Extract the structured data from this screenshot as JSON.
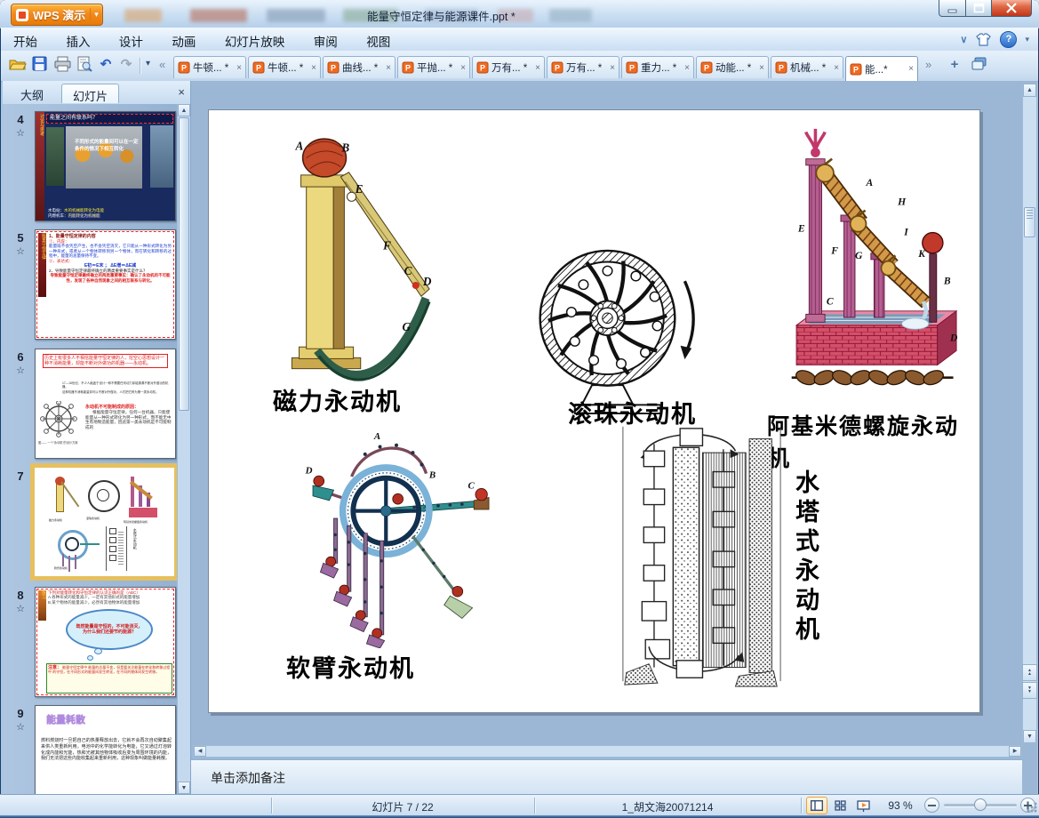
{
  "window": {
    "app_button": "WPS 演示",
    "title": "能量守恒定律与能源课件.ppt *"
  },
  "icons": {
    "ppt": "P",
    "close": "×",
    "star": "☆",
    "chev_left": "«",
    "chev_right": "»",
    "more": "▾",
    "undo": "↶",
    "redo": "↷",
    "plus": "+",
    "arrow_left": "◀",
    "arrow_right": "▶",
    "arrow_up": "▲",
    "arrow_down": "▼",
    "dropdown": "▾",
    "help": "?",
    "collapse": "∨"
  },
  "menu": {
    "items": [
      "开始",
      "插入",
      "设计",
      "动画",
      "幻灯片放映",
      "审阅",
      "视图"
    ]
  },
  "doc_tabs": [
    {
      "label": "牛顿... *"
    },
    {
      "label": "牛顿... *"
    },
    {
      "label": "曲线... *"
    },
    {
      "label": "平抛... *"
    },
    {
      "label": "万有... *"
    },
    {
      "label": "万有... *"
    },
    {
      "label": "重力... *"
    },
    {
      "label": "动能... *"
    },
    {
      "label": "机械... *"
    },
    {
      "label": "能...*"
    }
  ],
  "sidebar": {
    "outline_tab": "大纲",
    "slides_tab": "幻灯片",
    "slides": [
      {
        "n": "4",
        "star": "☆"
      },
      {
        "n": "5",
        "star": "☆"
      },
      {
        "n": "6",
        "star": "☆"
      },
      {
        "n": "7",
        "star": ""
      },
      {
        "n": "8",
        "star": "☆"
      },
      {
        "n": "9",
        "star": "☆"
      }
    ],
    "t4": {
      "banner": "讨论与思考",
      "title": "能量之间有联系吗？",
      "body1": "不同形式的能量间可以在一定",
      "body2": "条件的情况下相互转化",
      "foot1": "水电站：",
      "foot2": "内燃机车：",
      "foot3": "水的机械能转化为电能",
      "foot4": "内能转化为机械能"
    },
    "t5": {
      "banner": "能量守恒定律",
      "h1": "1、能量守恒定律的内容",
      "r1": "①、内容：",
      "b1": "能量既不会凭空产生，也不会凭空消灭，它只能从一种形式转化为另一种形式，或者从一个物体转移到另一个物体，而在转化和转移的过程中，能量的总量保持不变。",
      "r2": "②、表达式：",
      "f": "E初＝E末 ； ΔE增＝ΔE减",
      "h2": "2、导致能量守恒定律最终确立的两类重要事实是什么？",
      "b2": "导致能量守恒定律最终确立的两类重要事实：确认了永动机的不可能性，发现了各种自然现象之间的相互联系与转化。"
    },
    "t6": {
      "box": "历史上有很多人不相信能量守恒定律的人，挖空心思想设计一种不消耗能量，却能不断对外做功的机器——永动机。",
      "m1": "17—18世纪，不少人痴迷于设计一种不需要任何动力却能源源不断对外做功的机器。",
      "m2": "这种机器不消耗能量却可以不断对外做功，人们把它称为第一类永动机。",
      "red": "永动机不可能制成的原因：",
      "body": "根据能量守恒定律，任何一台机器，只能使能量从一种形式转化为另一种形式，而不能无中生有地制造能量，因此第一类永动机是不可能制成的",
      "cap": "图—— 一个“永动机”的设计方案"
    },
    "t8": {
      "banner": "练习",
      "top": "下列对能量转化和守恒定律的认识正确的是（ABC）",
      "oa": "A.各种形式的能量减少，一定有其他形式的能量增加",
      "ob": "B.某个物体的能量减少，必然有其他物体的能量增加",
      "cloud": "既然能量是守恒的，不可能消灭，为什么我们还要节约能源？",
      "note_t": "注意：",
      "note_b": "能量守恒定律中 能量的总量不变，但是要关注能量在转化和转移过程中 的守恒，在不同形式的能量间发生转化，在不同的物体间发生转移。"
    },
    "t9": {
      "title": "能量耗散",
      "body": "燃料燃烧时一旦把自己的热量释放出去，它就不会再次自动聚集起来供人类重新利用。电池中的化学能转化为电能，它又通过灯泡转化成内能和光能，热和光被其他物体吸收后变为周围环境的内能，我们无法把这些内能收集起来重新利用，这种现象叫做能量耗散。"
    }
  },
  "slide": {
    "machines": [
      {
        "caption": "磁力永动机",
        "letters": [
          "A",
          "B",
          "E",
          "F",
          "C",
          "D",
          "G"
        ]
      },
      {
        "caption": "滚珠永动机",
        "letters": []
      },
      {
        "caption": "阿基米德螺旋永动机",
        "letters": [
          "A",
          "H",
          "E",
          "F",
          "G",
          "I",
          "K",
          "B",
          "C",
          "D"
        ]
      },
      {
        "caption": "软臂永动机",
        "letters": [
          "A",
          "B",
          "C",
          "D"
        ]
      },
      {
        "caption": "水塔式永动机",
        "letters": []
      }
    ]
  },
  "notes": {
    "placeholder": "单击添加备注"
  },
  "status": {
    "slide_indicator": "幻灯片 7 / 22",
    "doc_name": "1_胡文海20071214",
    "zoom_level": "93 %"
  },
  "colors": {
    "wps_orange": "#f28a1e",
    "close_red": "#d04a32",
    "accent_blue": "#4a7ab5",
    "selection_gold": "#e6c05e",
    "canvas_bg": "#9cb7d5"
  }
}
